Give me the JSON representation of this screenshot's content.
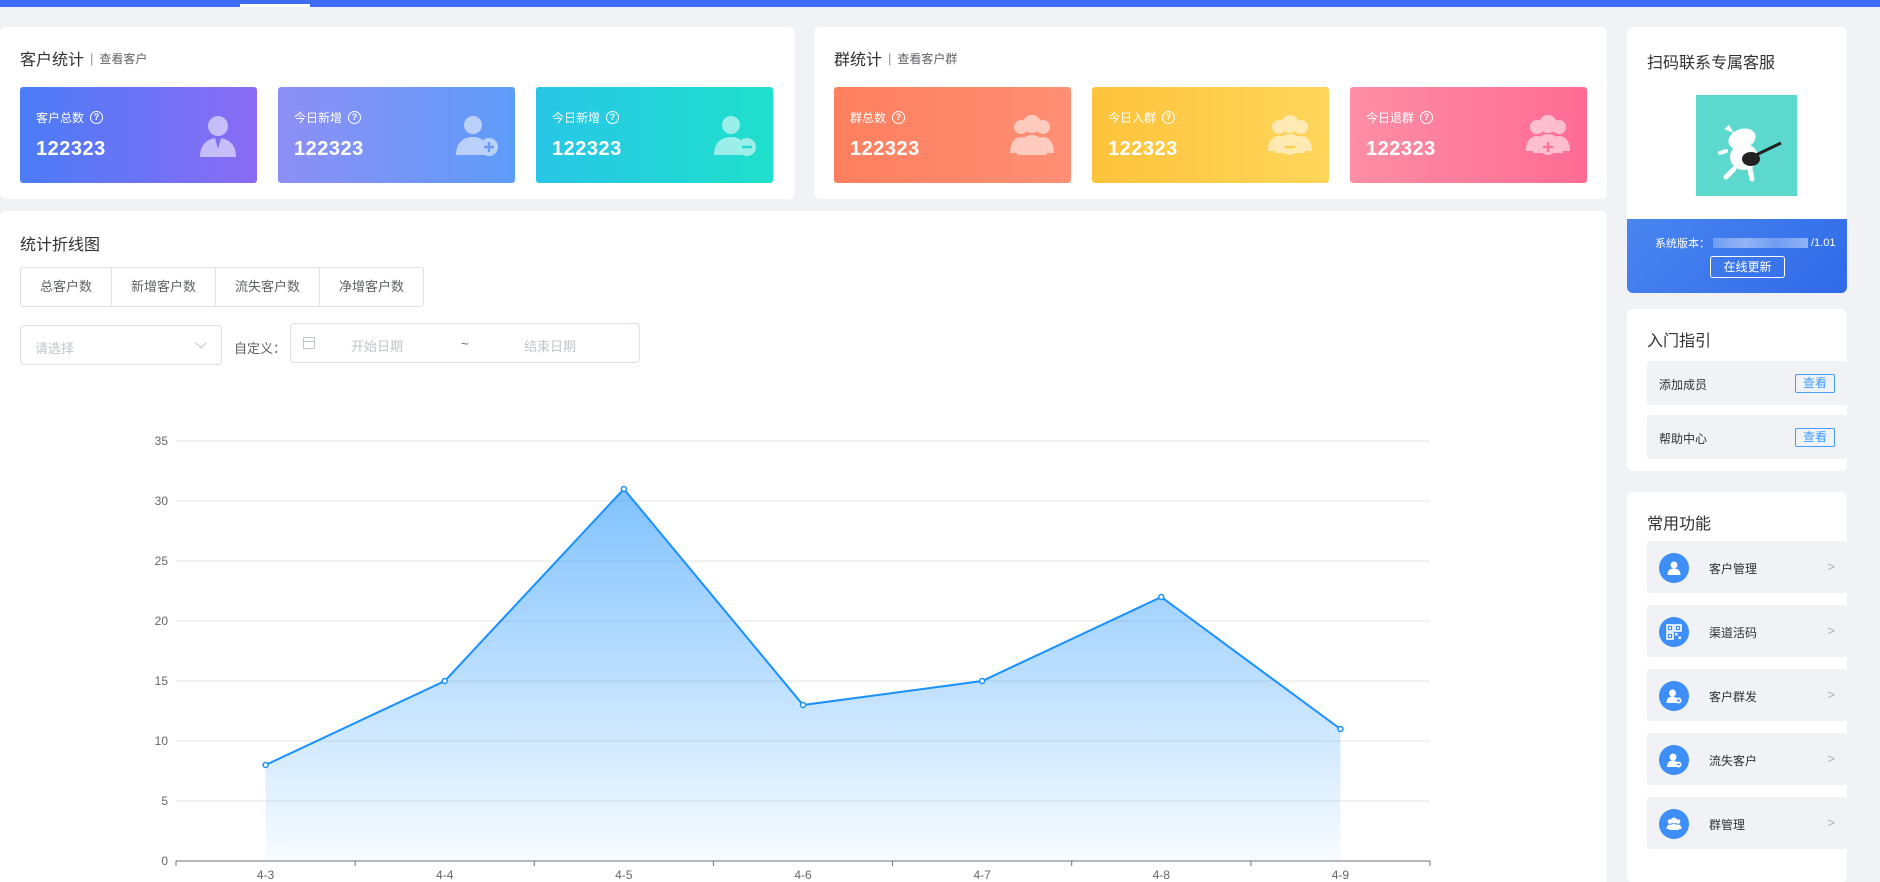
{
  "customer_stats": {
    "title": "客户统计",
    "link": "查看客户",
    "cards": [
      {
        "label": "客户总数",
        "value": "122323",
        "icon": "user-icon"
      },
      {
        "label": "今日新增",
        "value": "122323",
        "icon": "user-add-icon"
      },
      {
        "label": "今日新增",
        "value": "122323",
        "icon": "user-remove-icon"
      }
    ]
  },
  "group_stats": {
    "title": "群统计",
    "link": "查看客户群",
    "cards": [
      {
        "label": "群总数",
        "value": "122323",
        "icon": "group-icon"
      },
      {
        "label": "今日入群",
        "value": "122323",
        "icon": "group-remove-icon"
      },
      {
        "label": "今日退群",
        "value": "122323",
        "icon": "group-add-icon"
      }
    ]
  },
  "line_panel": {
    "title": "统计折线图",
    "tabs": [
      "总客户数",
      "新增客户数",
      "流失客户数",
      "净增客户数"
    ],
    "select_placeholder": "请选择",
    "custom_label": "自定义：",
    "start_placeholder": "开始日期",
    "range_separator": "~",
    "end_placeholder": "结束日期"
  },
  "chart_data": {
    "type": "area",
    "categories": [
      "4-3",
      "4-4",
      "4-5",
      "4-6",
      "4-7",
      "4-8",
      "4-9"
    ],
    "values": [
      8,
      15,
      31,
      13,
      15,
      22,
      11
    ],
    "ylim": [
      0,
      35
    ],
    "yticks": [
      0,
      5,
      10,
      15,
      20,
      25,
      30,
      35
    ],
    "grid": true,
    "color": "#1890ff"
  },
  "service": {
    "title": "扫码联系专属客服",
    "version_label": "系统版本：",
    "version_suffix": "/1.01",
    "update_button": "在线更新"
  },
  "guide": {
    "title": "入门指引",
    "items": [
      {
        "label": "添加成员",
        "button": "查看"
      },
      {
        "label": "帮助中心",
        "button": "查看"
      }
    ]
  },
  "functions": {
    "title": "常用功能",
    "items": [
      {
        "label": "客户管理",
        "icon": "customer-icon"
      },
      {
        "label": "渠道活码",
        "icon": "qrcode-icon"
      },
      {
        "label": "客户群发",
        "icon": "broadcast-icon"
      },
      {
        "label": "流失客户",
        "icon": "lost-customer-icon"
      },
      {
        "label": "群管理",
        "icon": "group-manage-icon"
      }
    ],
    "arrow": ">"
  }
}
